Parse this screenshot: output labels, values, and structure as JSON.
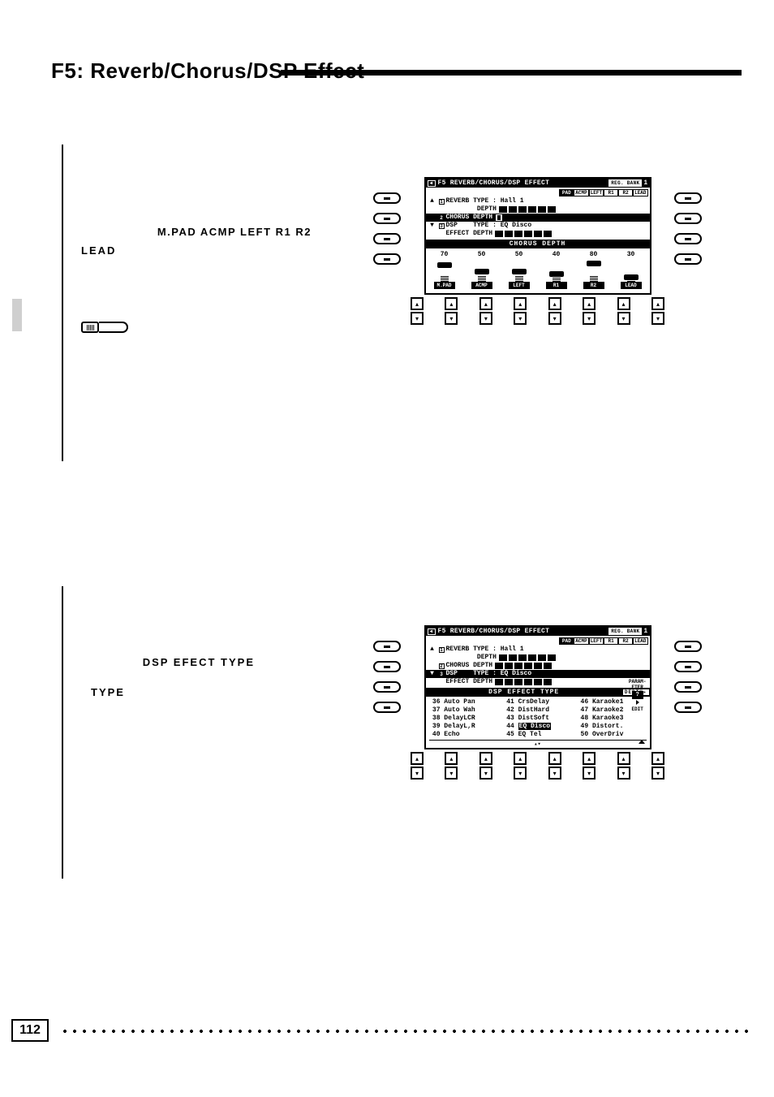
{
  "page": {
    "title": "F5: Reverb/Chorus/DSP Effect",
    "number": "112"
  },
  "left_upper": {
    "header_line": "M.PAD  ACMP  LEFT  R1  R2",
    "lead": "LEAD"
  },
  "left_lower": {
    "label1": "DSP EFECT TYPE",
    "label2": "TYPE"
  },
  "lcd1": {
    "title": "F5 REVERB/CHORUS/DSP EFFECT",
    "bank_label": "REG. BANK",
    "bank_num": "1",
    "tabs": [
      "PAD",
      "ACMP",
      "LEFT",
      "R1",
      "R2",
      "LEAD"
    ],
    "rows": [
      {
        "idx": "1",
        "l": "REVERB TYPE : ",
        "v": "Hall 1",
        "arrow": "▲"
      },
      {
        "idx": "",
        "l": "        DEPTH",
        "v": ""
      },
      {
        "idx": "2",
        "l": "CHORUS DEPTH",
        "v": "",
        "sel": true
      },
      {
        "idx": "3",
        "l": "DSP    TYPE : ",
        "v": "EQ Disco",
        "arrow": "▼"
      },
      {
        "idx": "",
        "l": "EFFECT DEPTH",
        "v": ""
      }
    ],
    "section": "CHORUS DEPTH",
    "sliders": [
      {
        "val": "70",
        "tag": "M.PAD",
        "knob": 4
      },
      {
        "val": "50",
        "tag": "ACMP",
        "knob": 12
      },
      {
        "val": "50",
        "tag": "LEFT",
        "knob": 12
      },
      {
        "val": "40",
        "tag": "R1",
        "knob": 15
      },
      {
        "val": "80",
        "tag": "R2",
        "knob": 2
      },
      {
        "val": "30",
        "tag": "LEAD",
        "knob": 19
      }
    ]
  },
  "lcd2": {
    "title": "F5 REVERB/CHORUS/DSP EFFECT",
    "bank_label": "REG. BANK",
    "bank_num": "1",
    "tabs": [
      "PAD",
      "ACMP",
      "LEFT",
      "R1",
      "R2",
      "LEAD"
    ],
    "rows": [
      {
        "idx": "1",
        "l": "REVERB TYPE : ",
        "v": "Hall 1",
        "arrow": "▲"
      },
      {
        "idx": "",
        "l": "        DEPTH",
        "v": ""
      },
      {
        "idx": "2",
        "l": "CHORUS DEPTH",
        "v": ""
      },
      {
        "idx": "3",
        "l": "DSP    TYPE : ",
        "v": "EQ Disco",
        "arrow": "▼",
        "sel": true
      },
      {
        "idx": "",
        "l": "EFFECT DEPTH",
        "v": ""
      }
    ],
    "param_edit": {
      "l1": "PARAM-",
      "l2": "ETER",
      "l3": "?",
      "l4": "EDIT"
    },
    "section_main": "DSP EFFECT TYPE",
    "section_side": "DEPTH",
    "list": {
      "col1": [
        {
          "n": "36",
          "t": "Auto Pan"
        },
        {
          "n": "37",
          "t": "Auto Wah"
        },
        {
          "n": "38",
          "t": "DelayLCR"
        },
        {
          "n": "39",
          "t": "DelayL,R"
        },
        {
          "n": "40",
          "t": "Echo"
        }
      ],
      "col2": [
        {
          "n": "41",
          "t": "CrsDelay"
        },
        {
          "n": "42",
          "t": "DistHard"
        },
        {
          "n": "43",
          "t": "DistSoft"
        },
        {
          "n": "44",
          "t": "EQ Disco",
          "sel": true
        },
        {
          "n": "45",
          "t": "EQ Tel"
        }
      ],
      "col3": [
        {
          "n": "46",
          "t": "Karaoke1"
        },
        {
          "n": "47",
          "t": "Karaoke2"
        },
        {
          "n": "48",
          "t": "Karaoke3"
        },
        {
          "n": "49",
          "t": "Distort."
        },
        {
          "n": "50",
          "t": "OverDriv"
        }
      ]
    }
  }
}
